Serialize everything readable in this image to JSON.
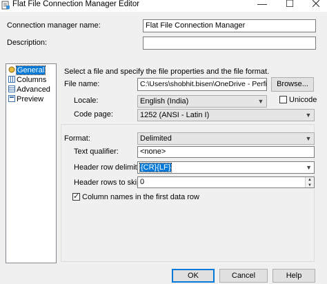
{
  "window": {
    "title": "Flat File Connection Manager Editor",
    "minimize": "—",
    "maximize": "☐"
  },
  "connection": {
    "name_label": "Connection manager name:",
    "name_value": "Flat File Connection Manager",
    "description_label": "Description:",
    "description_value": ""
  },
  "nav": {
    "items": [
      {
        "label": "General",
        "icon": "general-icon",
        "selected": true
      },
      {
        "label": "Columns",
        "icon": "columns-icon",
        "selected": false
      },
      {
        "label": "Advanced",
        "icon": "advanced-icon",
        "selected": false
      },
      {
        "label": "Preview",
        "icon": "preview-icon",
        "selected": false
      }
    ]
  },
  "general": {
    "instruction": "Select a file and specify the file properties and the file format.",
    "file_name_label": "File name:",
    "file_name_value": "C:\\Users\\shobhit.bisen\\OneDrive - Perficient,",
    "browse_label": "Browse...",
    "locale_label": "Locale:",
    "locale_value": "English (India)",
    "unicode_label": "Unicode",
    "unicode_checked": false,
    "code_page_label": "Code page:",
    "code_page_value": "1252  (ANSI - Latin I)"
  },
  "format": {
    "format_label": "Format:",
    "format_value": "Delimited",
    "text_qualifier_label": "Text qualifier:",
    "text_qualifier_value": "<none>",
    "header_row_delimiter_label": "Header row delimiter:",
    "header_row_delimiter_value": "{CR}{LF}",
    "header_rows_skip_label": "Header rows to skip:",
    "header_rows_skip_value": "0",
    "column_names_label": "Column names in the first data row",
    "column_names_checked": true
  },
  "footer": {
    "ok_label": "OK",
    "cancel_label": "Cancel",
    "help_label": "Help"
  },
  "colors": {
    "selection": "#0078d7",
    "window_bg": "#f0f0f0"
  }
}
